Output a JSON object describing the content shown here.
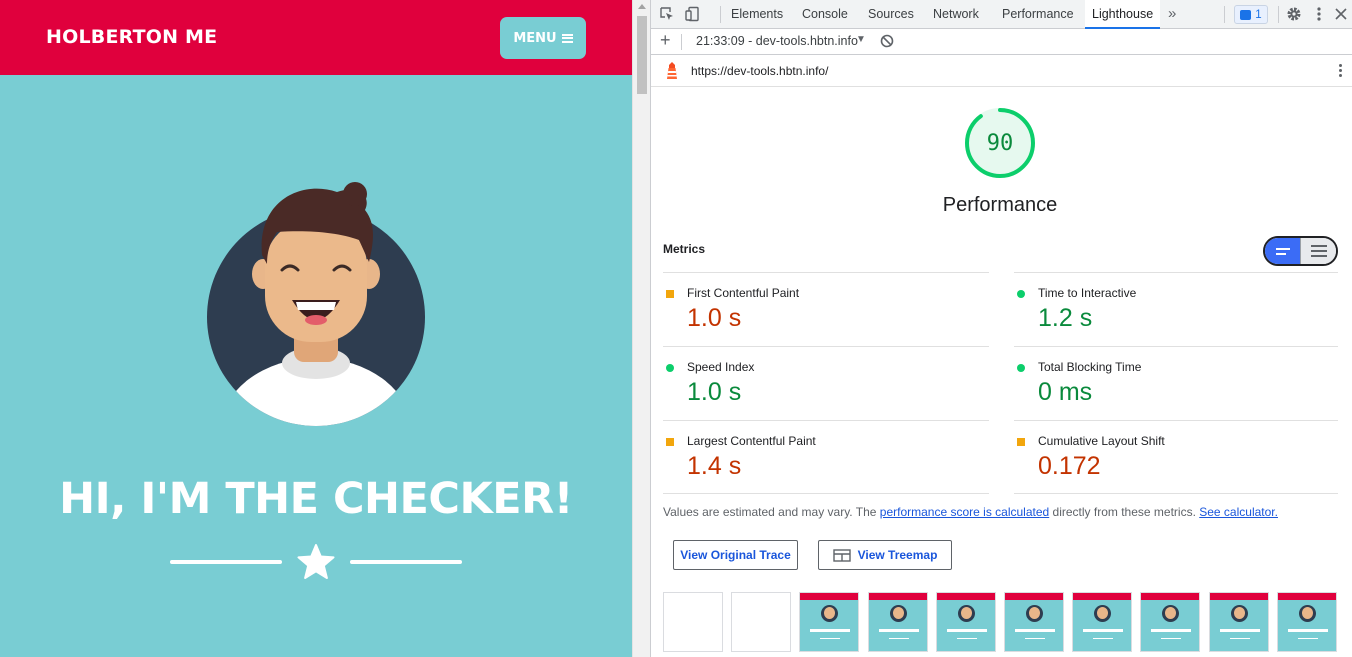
{
  "site": {
    "brand": "HOLBERTON ME",
    "menu_label": "MENU",
    "hero_title": "HI, I'M THE CHECKER!",
    "colors": {
      "nav": "#e0003d",
      "background": "#79cdd3"
    }
  },
  "devtools": {
    "tabs": [
      {
        "label": "Elements",
        "active": false
      },
      {
        "label": "Console",
        "active": false
      },
      {
        "label": "Sources",
        "active": false
      },
      {
        "label": "Network",
        "active": false
      },
      {
        "label": "Performance",
        "active": false
      },
      {
        "label": "Lighthouse",
        "active": true
      }
    ],
    "more_tabs": "»",
    "issues_count": "1",
    "report_select": "21:33:09 - dev-tools.hbtn.info",
    "url": "https://dev-tools.hbtn.info/",
    "report": {
      "score": "90",
      "score_fraction": 0.9,
      "category": "Performance",
      "metrics_title": "Metrics",
      "metrics": [
        {
          "label": "First Contentful Paint",
          "value": "1.0 s",
          "status": "average"
        },
        {
          "label": "Time to Interactive",
          "value": "1.2 s",
          "status": "pass"
        },
        {
          "label": "Speed Index",
          "value": "1.0 s",
          "status": "pass"
        },
        {
          "label": "Total Blocking Time",
          "value": "0 ms",
          "status": "pass"
        },
        {
          "label": "Largest Contentful Paint",
          "value": "1.4 s",
          "status": "average"
        },
        {
          "label": "Cumulative Layout Shift",
          "value": "0.172",
          "status": "average"
        }
      ],
      "note_prefix": "Values are estimated and may vary. The ",
      "note_link1": "performance score is calculated",
      "note_middle": " directly from these metrics. ",
      "note_link2": "See calculator.",
      "btn_trace": "View Original Trace",
      "btn_treemap": "View Treemap",
      "filmstrip": [
        {
          "loaded": false
        },
        {
          "loaded": false
        },
        {
          "loaded": true
        },
        {
          "loaded": true
        },
        {
          "loaded": true
        },
        {
          "loaded": true
        },
        {
          "loaded": true
        },
        {
          "loaded": true
        },
        {
          "loaded": true
        },
        {
          "loaded": true
        }
      ]
    },
    "colors": {
      "accent": "#1a73e8",
      "pass": "#0cce6b",
      "average": "#f2a60d",
      "fail_text": "#c33300"
    }
  }
}
